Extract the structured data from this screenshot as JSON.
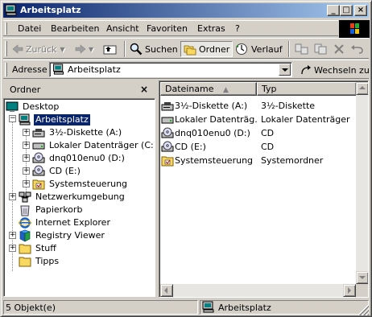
{
  "window": {
    "title": "Arbeitsplatz",
    "buttons": {
      "minimize": "_",
      "maximize": "□",
      "close": "×"
    }
  },
  "menubar": {
    "items": [
      "Datei",
      "Bearbeiten",
      "Ansicht",
      "Favoriten",
      "Extras",
      "?"
    ]
  },
  "toolbar": {
    "back_label": "Zurück",
    "search_label": "Suchen",
    "folders_label": "Ordner",
    "history_label": "Verlauf"
  },
  "address": {
    "label": "Adresse",
    "value": "Arbeitsplatz",
    "go_label": "Wechseln zu"
  },
  "folder_pane": {
    "title": "Ordner",
    "close": "×",
    "tree": [
      {
        "label": "Desktop",
        "icon": "desktop-icon",
        "level": 0
      },
      {
        "label": "Arbeitsplatz",
        "icon": "my-computer-icon",
        "level": 1,
        "selected": true,
        "expander": "−"
      },
      {
        "label": "3½-Diskette (A:)",
        "icon": "floppy-drive-icon",
        "level": 2,
        "expander": "+"
      },
      {
        "label": "Lokaler Datenträger (C:)",
        "icon": "hard-drive-icon",
        "level": 2,
        "expander": "+"
      },
      {
        "label": "dnq010enu0 (D:)",
        "icon": "cd-drive-icon",
        "level": 2,
        "expander": "+"
      },
      {
        "label": "CD (E:)",
        "icon": "cd-drive-icon",
        "level": 2,
        "expander": "+"
      },
      {
        "label": "Systemsteuerung",
        "icon": "control-panel-icon",
        "level": 2,
        "expander": "+"
      },
      {
        "label": "Netzwerkumgebung",
        "icon": "network-icon",
        "level": 1,
        "expander": "+"
      },
      {
        "label": "Papierkorb",
        "icon": "recycle-bin-icon",
        "level": 1
      },
      {
        "label": "Internet Explorer",
        "icon": "internet-explorer-icon",
        "level": 1
      },
      {
        "label": "Registry Viewer",
        "icon": "registry-viewer-icon",
        "level": 1,
        "expander": "+"
      },
      {
        "label": "Stuff",
        "icon": "folder-icon",
        "level": 1,
        "expander": "+"
      },
      {
        "label": "Tipps",
        "icon": "folder-icon",
        "level": 1
      }
    ]
  },
  "file_list": {
    "columns": [
      "Dateiname",
      "Typ"
    ],
    "rows": [
      {
        "name": "3½-Diskette (A:)",
        "type": "3½-Diskette",
        "icon": "floppy-drive-icon"
      },
      {
        "name": "Lokaler Datenträg...",
        "type": "Lokaler Datenträger",
        "icon": "hard-drive-icon"
      },
      {
        "name": "dnq010enu0 (D:)",
        "type": "CD",
        "icon": "cd-drive-icon"
      },
      {
        "name": "CD (E:)",
        "type": "CD",
        "icon": "cd-drive-icon"
      },
      {
        "name": "Systemsteuerung",
        "type": "Systemordner",
        "icon": "control-panel-icon"
      }
    ]
  },
  "statusbar": {
    "count": "5 Objekt(e)",
    "location": "Arbeitsplatz"
  },
  "colors": {
    "titlebar_start": "#0a246a",
    "titlebar_end": "#a6caf0",
    "face": "#d4d0c8",
    "selection": "#0a246a"
  }
}
